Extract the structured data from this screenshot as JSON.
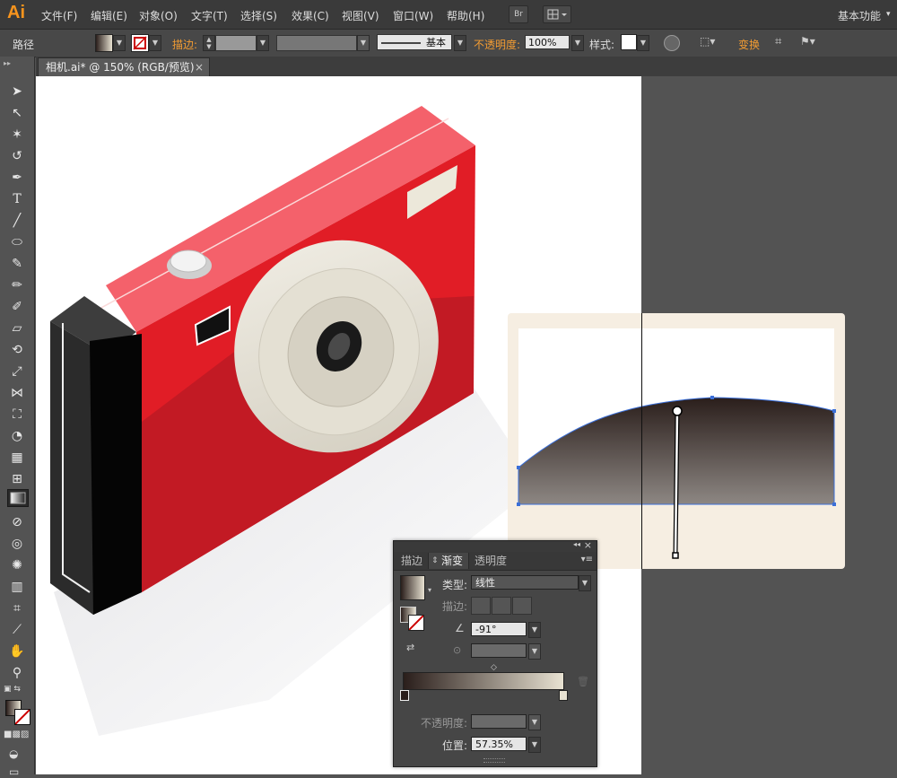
{
  "app": {
    "logo": "Ai",
    "menus": [
      "文件(F)",
      "编辑(E)",
      "对象(O)",
      "文字(T)",
      "选择(S)",
      "效果(C)",
      "视图(V)",
      "窗口(W)",
      "帮助(H)"
    ],
    "bridge_label": "Br",
    "workspace": "基本功能"
  },
  "control_bar": {
    "object_type": "路径",
    "stroke_label": "描边:",
    "stroke_style": "基本",
    "opacity_label": "不透明度:",
    "opacity_value": "100%",
    "style_label": "样式:",
    "transform_label": "变换"
  },
  "document": {
    "tab_title": "相机.ai* @ 150% (RGB/预览)",
    "close_glyph": "×"
  },
  "gradient_panel": {
    "collapse_glyph": "◂◂",
    "close_glyph": "×",
    "tabs": [
      "描边",
      "渐变",
      "透明度"
    ],
    "active_tab": "渐变",
    "type_label": "类型:",
    "type_value": "线性",
    "stroke_label": "描边:",
    "angle_value": "-91°",
    "opacity_label": "不透明度:",
    "location_label": "位置:",
    "location_value": "57.35%",
    "gradient_start_color": "#2a1e1b",
    "gradient_end_color": "#e8e2d2"
  },
  "colors": {
    "camera_red": "#e11d26",
    "camera_dark": "#2b2b2b",
    "lens_cream": "#e9e5da",
    "selection_blue": "#3b6fd8",
    "shape_bg": "#f6eee2",
    "ui_orange": "#f39c32"
  }
}
